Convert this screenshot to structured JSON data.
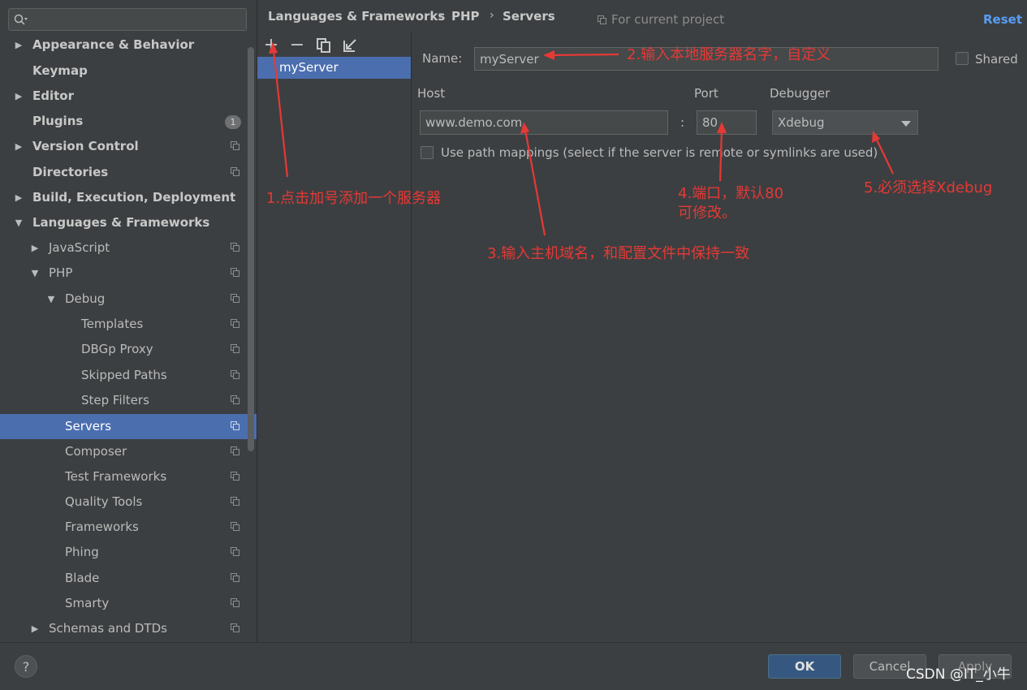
{
  "search": {
    "placeholder": ""
  },
  "sidebar": {
    "items": [
      {
        "label": "Appearance & Behavior",
        "arrow": "▶"
      },
      {
        "label": "Keymap",
        "arrow": ""
      },
      {
        "label": "Editor",
        "arrow": "▶"
      },
      {
        "label": "Plugins",
        "arrow": "",
        "badge": "1"
      },
      {
        "label": "Version Control",
        "arrow": "▶"
      },
      {
        "label": "Directories",
        "arrow": ""
      },
      {
        "label": "Build, Execution, Deployment",
        "arrow": "▶"
      },
      {
        "label": "Languages & Frameworks",
        "arrow": "▼"
      },
      {
        "label": "JavaScript",
        "arrow": "▶"
      },
      {
        "label": "PHP",
        "arrow": "▼"
      },
      {
        "label": "Debug",
        "arrow": "▼"
      },
      {
        "label": "Templates",
        "arrow": ""
      },
      {
        "label": "DBGp Proxy",
        "arrow": ""
      },
      {
        "label": "Skipped Paths",
        "arrow": ""
      },
      {
        "label": "Step Filters",
        "arrow": ""
      },
      {
        "label": "Servers",
        "arrow": ""
      },
      {
        "label": "Composer",
        "arrow": ""
      },
      {
        "label": "Test Frameworks",
        "arrow": ""
      },
      {
        "label": "Quality Tools",
        "arrow": ""
      },
      {
        "label": "Frameworks",
        "arrow": ""
      },
      {
        "label": "Phing",
        "arrow": ""
      },
      {
        "label": "Blade",
        "arrow": ""
      },
      {
        "label": "Smarty",
        "arrow": ""
      },
      {
        "label": "Schemas and DTDs",
        "arrow": "▶"
      }
    ]
  },
  "breadcrumb": {
    "items": [
      "Languages & Frameworks",
      "PHP",
      "Servers"
    ],
    "separator": "›"
  },
  "header": {
    "project_hint": "For current project",
    "reset": "Reset"
  },
  "toolbar": {
    "add": "+",
    "remove": "−"
  },
  "servers": {
    "items": [
      "myServer"
    ]
  },
  "form": {
    "name_label": "Name:",
    "name_value": "myServer",
    "shared_label": "Shared",
    "host_label": "Host",
    "host_value": "www.demo.com",
    "port_label": "Port",
    "port_sep": ":",
    "port_value": "80",
    "debugger_label": "Debugger",
    "debugger_value": "Xdebug",
    "path_mappings_label": "Use path mappings (select if the server is remote or symlinks are used)"
  },
  "annotations": {
    "step1": "1.点击加号添加一个服务器",
    "step2": "2.输入本地服务器名字，自定义",
    "step3": "3.输入主机域名，和配置文件中保持一致",
    "step4_line1": "4.端口，默认80",
    "step4_line2": "可修改。",
    "step5": "5.必须选择Xdebug"
  },
  "footer": {
    "help": "?",
    "ok": "OK",
    "cancel": "Cancel",
    "apply": "Apply",
    "watermark": "CSDN @IT_小牛"
  },
  "colors": {
    "accent": "#4b6eaf",
    "annotation": "#e53935",
    "link": "#589df6"
  }
}
